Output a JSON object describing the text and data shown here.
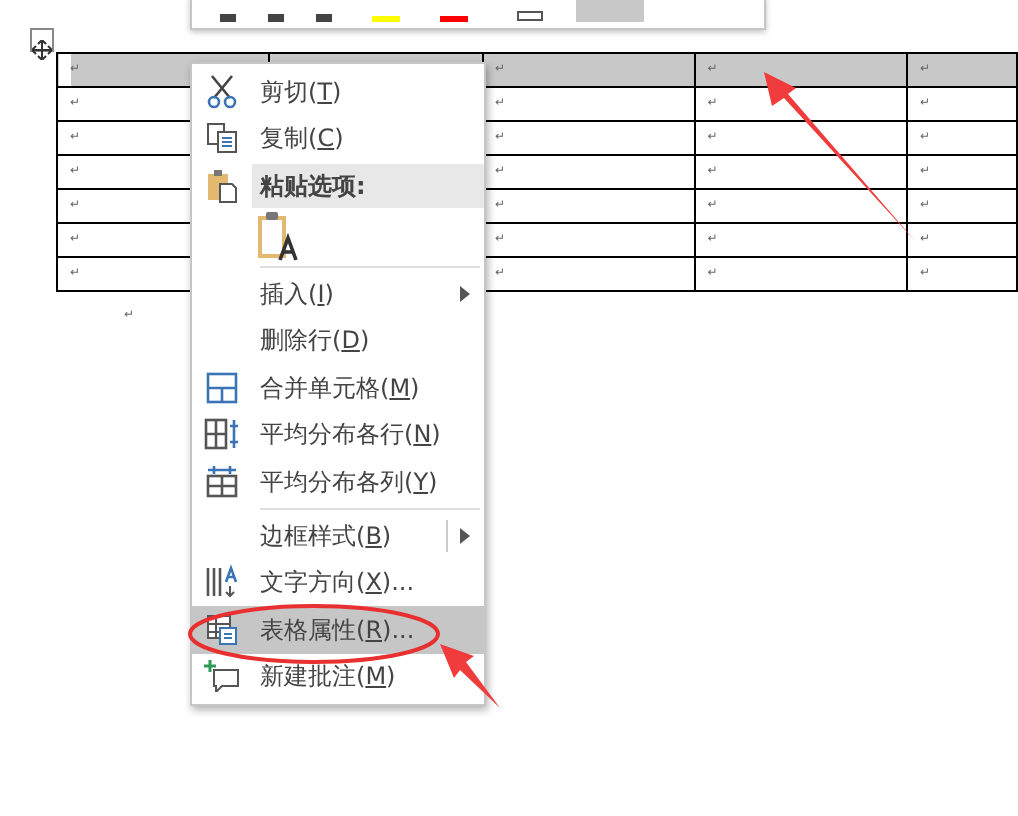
{
  "mini_toolbar": {
    "swatches": [
      {
        "color": "#ffff00"
      },
      {
        "color": "#ff0000"
      }
    ]
  },
  "table": {
    "rows": [
      {
        "selected": true,
        "cells": [
          "↵",
          null,
          "↵",
          "↵",
          "↵"
        ]
      },
      {
        "selected": false,
        "cells": [
          "↵",
          null,
          "↵",
          "↵",
          "↵"
        ]
      },
      {
        "selected": false,
        "cells": [
          "↵",
          null,
          "↵",
          "↵",
          "↵"
        ]
      },
      {
        "selected": false,
        "cells": [
          "↵",
          null,
          "↵",
          "↵",
          "↵"
        ]
      },
      {
        "selected": false,
        "cells": [
          "↵",
          null,
          "↵",
          "↵",
          "↵"
        ]
      },
      {
        "selected": false,
        "cells": [
          "↵",
          null,
          "↵",
          "↵",
          "↵"
        ]
      },
      {
        "selected": false,
        "cells": [
          "↵",
          null,
          "↵",
          "↵",
          "↵"
        ]
      }
    ]
  },
  "paragraph_mark": "↵",
  "context_menu": {
    "items": [
      {
        "kind": "item",
        "text": "剪切(",
        "key": "T",
        "after": ")",
        "selected": false
      },
      {
        "kind": "item",
        "text": "复制(",
        "key": "C",
        "after": ")",
        "selected": false
      },
      {
        "kind": "header",
        "text": "粘贴选项:"
      },
      {
        "kind": "paste-option"
      },
      {
        "kind": "separator"
      },
      {
        "kind": "item",
        "text": "插入(",
        "key": "I",
        "after": ")",
        "submenu": true,
        "selected": false
      },
      {
        "kind": "item",
        "text": "删除行(",
        "key": "D",
        "after": ")",
        "selected": false
      },
      {
        "kind": "item",
        "text": "合并单元格(",
        "key": "M",
        "after": ")",
        "selected": false
      },
      {
        "kind": "item",
        "text": "平均分布各行(",
        "key": "N",
        "after": ")",
        "selected": false
      },
      {
        "kind": "item",
        "text": "平均分布各列(",
        "key": "Y",
        "after": ")",
        "selected": false
      },
      {
        "kind": "separator"
      },
      {
        "kind": "item",
        "text": "边框样式(",
        "key": "B",
        "after": ")",
        "submenu": true,
        "split": true,
        "selected": false
      },
      {
        "kind": "item",
        "text": "文字方向(",
        "key": "X",
        "after": ")...",
        "selected": false
      },
      {
        "kind": "item",
        "text": "表格属性(",
        "key": "R",
        "after": ")...",
        "selected": true
      },
      {
        "kind": "item",
        "text": "新建批注(",
        "key": "M",
        "after": ")",
        "selected": false
      }
    ]
  }
}
